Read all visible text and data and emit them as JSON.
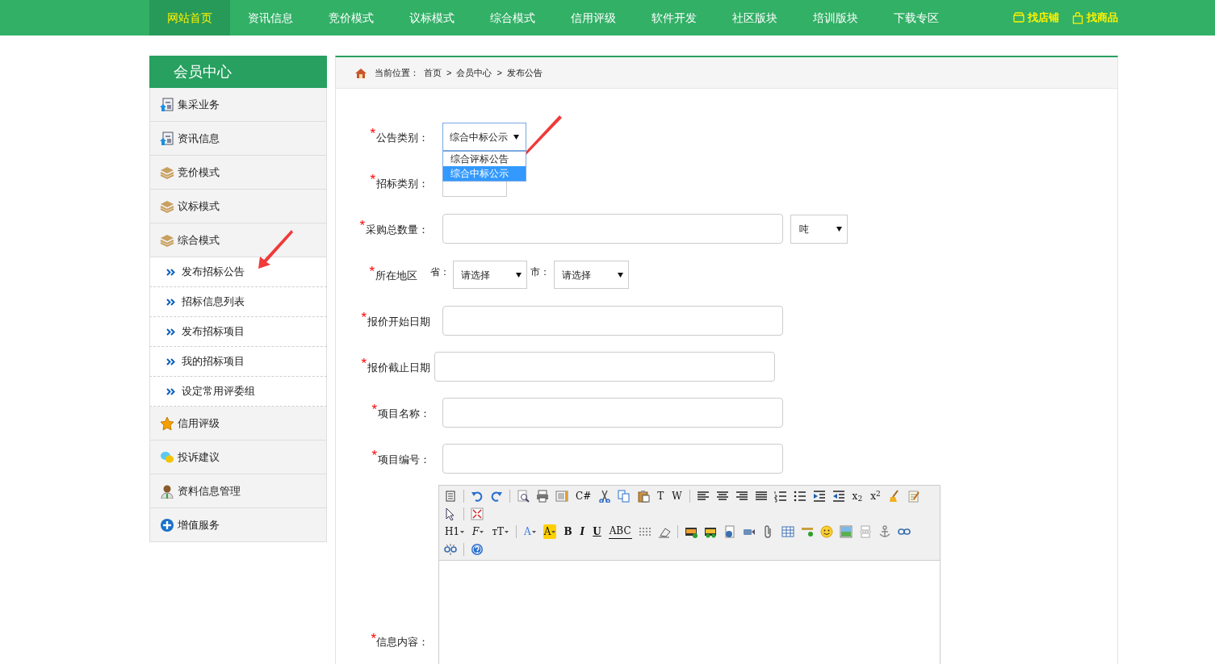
{
  "nav": {
    "items": [
      {
        "label": "网站首页",
        "selected": true
      },
      {
        "label": "资讯信息",
        "selected": false
      },
      {
        "label": "竞价模式",
        "selected": false
      },
      {
        "label": "议标模式",
        "selected": false
      },
      {
        "label": "综合模式",
        "selected": false
      },
      {
        "label": "信用评级",
        "selected": false
      },
      {
        "label": "软件开发",
        "selected": false
      },
      {
        "label": "社区版块",
        "selected": false
      },
      {
        "label": "培训版块",
        "selected": false
      },
      {
        "label": "下载专区",
        "selected": false
      }
    ],
    "links": [
      "找店铺",
      "找商品"
    ]
  },
  "sidebar": {
    "title": "会员中心",
    "items": [
      {
        "label": "集采业务"
      },
      {
        "label": "资讯信息"
      },
      {
        "label": "竞价模式"
      },
      {
        "label": "议标模式"
      },
      {
        "label": "综合模式",
        "expanded": true,
        "children": [
          {
            "label": "发布招标公告"
          },
          {
            "label": "招标信息列表"
          },
          {
            "label": "发布招标项目"
          },
          {
            "label": "我的招标项目"
          },
          {
            "label": "设定常用评委组"
          }
        ]
      },
      {
        "label": "信用评级"
      },
      {
        "label": "投诉建议"
      },
      {
        "label": "资料信息管理"
      },
      {
        "label": "增值服务"
      }
    ]
  },
  "breadcrumb": {
    "label": "当前位置：",
    "separator": ">",
    "items": [
      "首页",
      "会员中心",
      "发布公告"
    ]
  },
  "form": {
    "rows": [
      {
        "kind": "dropdown",
        "label": "公告类别：",
        "value": "综合中标公示",
        "options": [
          {
            "label": "综合评标公告",
            "selected": false
          },
          {
            "label": "综合中标公示",
            "selected": true
          }
        ]
      },
      {
        "kind": "select",
        "label": "招标类别："
      },
      {
        "kind": "unit",
        "label": "采购总数量：",
        "unit": "吨"
      },
      {
        "kind": "region",
        "label": "所在地区",
        "province_label": "省：",
        "province": "请选择",
        "city_label": "市：",
        "city": "请选择"
      },
      {
        "kind": "input",
        "label": "报价开始日期"
      },
      {
        "kind": "input",
        "label": "报价截止日期"
      },
      {
        "kind": "input",
        "label": "项目名称："
      },
      {
        "kind": "input",
        "label": "项目编号："
      }
    ],
    "required_mark": "*"
  },
  "editor": {
    "label": "信息内容：",
    "toolbar": [
      {
        "kind": "icon"
      },
      {
        "kind": "sep"
      },
      {
        "kind": "icon"
      },
      {
        "kind": "icon"
      },
      {
        "kind": "sep"
      },
      {
        "kind": "icon"
      },
      {
        "kind": "icon"
      },
      {
        "kind": "icon"
      },
      {
        "kind": "text",
        "label": "C#"
      },
      {
        "kind": "icon"
      },
      {
        "kind": "icon"
      },
      {
        "kind": "icon"
      },
      {
        "kind": "text",
        "label": "T"
      },
      {
        "kind": "text",
        "label": "W"
      },
      {
        "kind": "sep"
      },
      {
        "kind": "icon"
      },
      {
        "kind": "icon"
      },
      {
        "kind": "icon"
      },
      {
        "kind": "icon"
      },
      {
        "kind": "icon"
      },
      {
        "kind": "icon"
      },
      {
        "kind": "icon"
      },
      {
        "kind": "icon"
      },
      {
        "kind": "text",
        "label": "x$_{2}$"
      },
      {
        "kind": "text",
        "label": "x$^{2}$"
      },
      {
        "kind": "icon"
      },
      {
        "kind": "icon"
      },
      {
        "kind": "break"
      },
      {
        "kind": "icon"
      },
      {
        "kind": "sep"
      },
      {
        "kind": "icon"
      },
      {
        "kind": "break"
      },
      {
        "kind": "text",
        "label": "H1",
        "dropdown": true
      },
      {
        "kind": "text",
        "label": "F",
        "dropdown": true,
        "italic": true
      },
      {
        "kind": "text",
        "label": "тT",
        "dropdown": true
      },
      {
        "kind": "sep"
      },
      {
        "kind": "text",
        "label": "A",
        "dropdown": true,
        "color": "#3b7de0"
      },
      {
        "kind": "text",
        "label": "A",
        "dropdown": true,
        "highlight": true
      },
      {
        "kind": "text",
        "label": "B",
        "bold": true
      },
      {
        "kind": "text",
        "label": "I",
        "bold": true,
        "italic": true
      },
      {
        "kind": "text",
        "label": "U",
        "bold": true,
        "underline": true
      },
      {
        "kind": "text",
        "label": "ABC",
        "strike": true
      },
      {
        "kind": "icon"
      },
      {
        "kind": "icon"
      },
      {
        "kind": "sep"
      },
      {
        "kind": "icon"
      },
      {
        "kind": "icon"
      },
      {
        "kind": "icon"
      },
      {
        "kind": "icon"
      },
      {
        "kind": "icon"
      },
      {
        "kind": "icon"
      },
      {
        "kind": "icon"
      },
      {
        "kind": "icon"
      },
      {
        "kind": "icon"
      },
      {
        "kind": "icon"
      },
      {
        "kind": "icon"
      },
      {
        "kind": "icon"
      },
      {
        "kind": "break"
      },
      {
        "kind": "icon"
      },
      {
        "kind": "sep"
      },
      {
        "kind": "icon"
      }
    ]
  }
}
